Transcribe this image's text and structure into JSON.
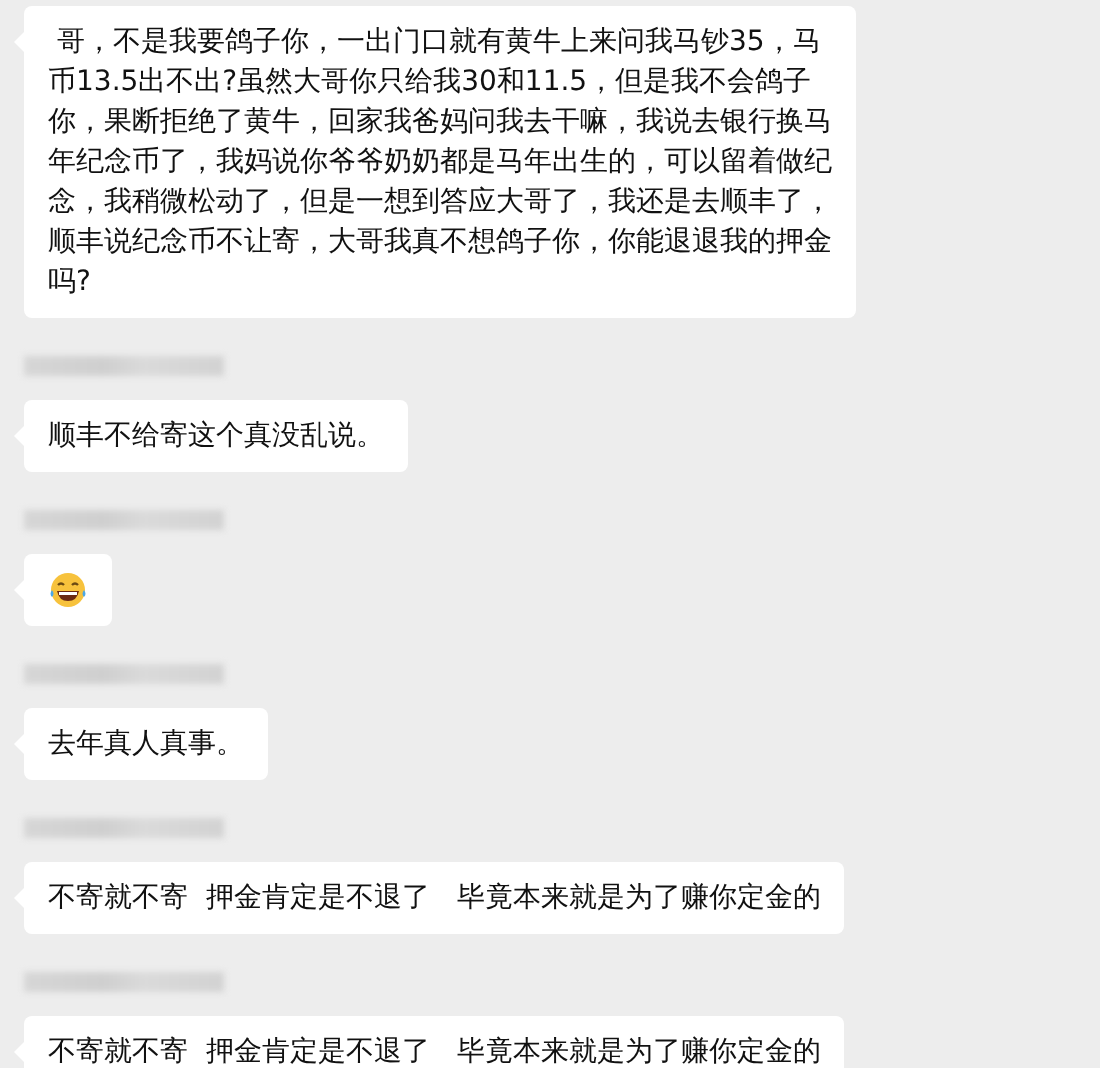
{
  "messages": [
    {
      "kind": "text",
      "name_blurred": false,
      "text": " 哥，不是我要鸽子你，一出门口就有黄牛上来问我马钞35，马币13.5出不出?虽然大哥你只给我30和11.5，但是我不会鸽子你，果断拒绝了黄牛，回家我爸妈问我去干嘛，我说去银行换马年纪念币了，我妈说你爷爷奶奶都是马年出生的，可以留着做纪念，我稍微松动了，但是一想到答应大哥了，我还是去顺丰了，顺丰说纪念币不让寄，大哥我真不想鸽子你，你能退退我的押金吗?"
    },
    {
      "kind": "text",
      "name_blurred": true,
      "text": "顺丰不给寄这个真没乱说。"
    },
    {
      "kind": "emoji",
      "name_blurred": true
    },
    {
      "kind": "text",
      "name_blurred": true,
      "text": "去年真人真事。"
    },
    {
      "kind": "text",
      "name_blurred": true,
      "text": "不寄就不寄  押金肯定是不退了   毕竟本来就是为了赚你定金的"
    },
    {
      "kind": "text",
      "name_blurred": true,
      "text": "不寄就不寄  押金肯定是不退了   毕竟本来就是为了赚你定金的"
    }
  ]
}
